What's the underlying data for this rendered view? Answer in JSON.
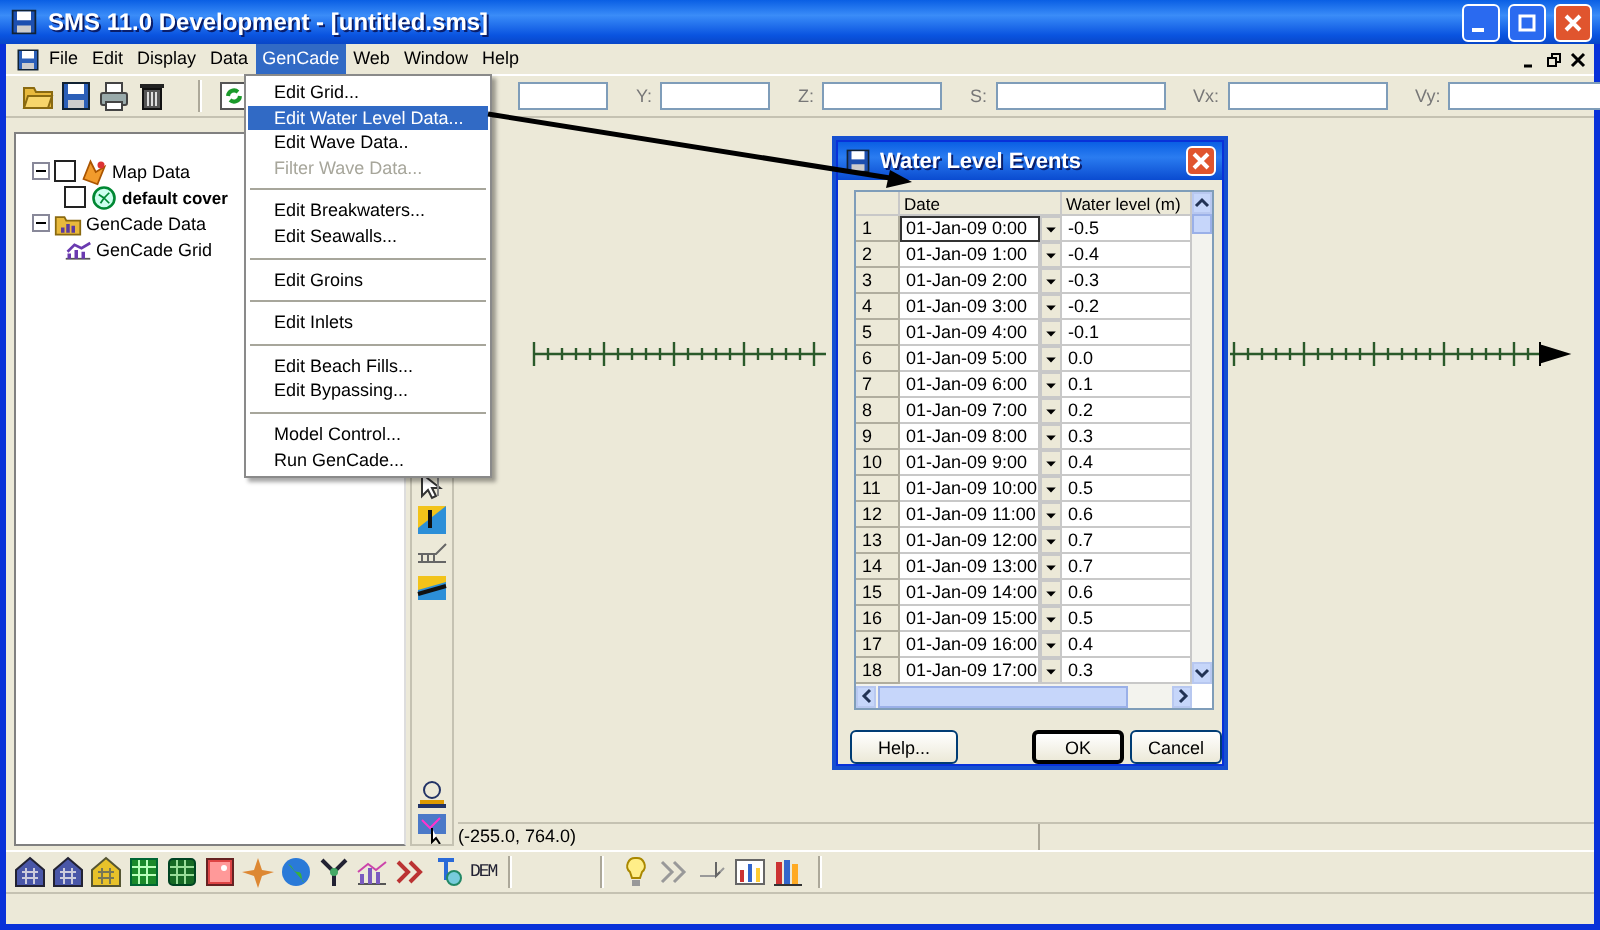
{
  "window": {
    "title": "SMS 11.0 Development - [untitled.sms]"
  },
  "menu_bar": [
    {
      "label": "File",
      "selected": false
    },
    {
      "label": "Edit",
      "selected": false
    },
    {
      "label": "Display",
      "selected": false
    },
    {
      "label": "Data",
      "selected": false
    },
    {
      "label": "GenCade",
      "selected": true
    },
    {
      "label": "Web",
      "selected": false
    },
    {
      "label": "Window",
      "selected": false
    },
    {
      "label": "Help",
      "selected": false
    }
  ],
  "open_menu": {
    "groups": [
      [
        {
          "label": "Edit Grid...",
          "selected": false,
          "disabled": false
        },
        {
          "label": "Edit Water Level Data...",
          "selected": true,
          "disabled": false
        },
        {
          "label": "Edit Wave Data..",
          "selected": false,
          "disabled": false
        },
        {
          "label": "Filter Wave Data...",
          "selected": false,
          "disabled": true
        }
      ],
      [
        {
          "label": "Edit Breakwaters...",
          "selected": false,
          "disabled": false
        },
        {
          "label": "Edit Seawalls...",
          "selected": false,
          "disabled": false
        }
      ],
      [
        {
          "label": "Edit Groins",
          "selected": false,
          "disabled": false
        }
      ],
      [
        {
          "label": "Edit Inlets",
          "selected": false,
          "disabled": false
        }
      ],
      [
        {
          "label": "Edit Beach Fills...",
          "selected": false,
          "disabled": false
        },
        {
          "label": "Edit Bypassing...",
          "selected": false,
          "disabled": false
        }
      ],
      [
        {
          "label": "Model Control...",
          "selected": false,
          "disabled": false
        },
        {
          "label": "Run GenCade...",
          "selected": false,
          "disabled": false
        }
      ]
    ]
  },
  "coordinate_fields": [
    {
      "label": "Y:"
    },
    {
      "label": "Z:"
    },
    {
      "label": "S:"
    },
    {
      "label": "Vx:"
    },
    {
      "label": "Vy:"
    }
  ],
  "tree": [
    {
      "label": "Map Data",
      "expanded": true,
      "checked": false,
      "active": false,
      "children": [
        {
          "label": "default cover",
          "checked": false,
          "active": true
        }
      ]
    },
    {
      "label": "GenCade Data",
      "expanded": true,
      "active": false,
      "children": [
        {
          "label": "GenCade Grid",
          "active": false
        }
      ]
    }
  ],
  "status": {
    "coordinates": "(-255.0, 764.0)"
  },
  "bottom_toolbar": {
    "dem_button": "DEM"
  },
  "dialog": {
    "title": "Water Level Events",
    "columns": [
      "Date",
      "Water level (m)"
    ],
    "rows": [
      {
        "number": "1",
        "date": "01-Jan-09 0:00",
        "water_level": "-0.5",
        "focused": true
      },
      {
        "number": "2",
        "date": "01-Jan-09 1:00",
        "water_level": "-0.4",
        "focused": false
      },
      {
        "number": "3",
        "date": "01-Jan-09 2:00",
        "water_level": "-0.3",
        "focused": false
      },
      {
        "number": "4",
        "date": "01-Jan-09 3:00",
        "water_level": "-0.2",
        "focused": false
      },
      {
        "number": "5",
        "date": "01-Jan-09 4:00",
        "water_level": "-0.1",
        "focused": false
      },
      {
        "number": "6",
        "date": "01-Jan-09 5:00",
        "water_level": "0.0",
        "focused": false
      },
      {
        "number": "7",
        "date": "01-Jan-09 6:00",
        "water_level": "0.1",
        "focused": false
      },
      {
        "number": "8",
        "date": "01-Jan-09 7:00",
        "water_level": "0.2",
        "focused": false
      },
      {
        "number": "9",
        "date": "01-Jan-09 8:00",
        "water_level": "0.3",
        "focused": false
      },
      {
        "number": "10",
        "date": "01-Jan-09 9:00",
        "water_level": "0.4",
        "focused": false
      },
      {
        "number": "11",
        "date": "01-Jan-09 10:00",
        "water_level": "0.5",
        "focused": false
      },
      {
        "number": "12",
        "date": "01-Jan-09 11:00",
        "water_level": "0.6",
        "focused": false
      },
      {
        "number": "13",
        "date": "01-Jan-09 12:00",
        "water_level": "0.7",
        "focused": false
      },
      {
        "number": "14",
        "date": "01-Jan-09 13:00",
        "water_level": "0.7",
        "focused": false
      },
      {
        "number": "15",
        "date": "01-Jan-09 14:00",
        "water_level": "0.6",
        "focused": false
      },
      {
        "number": "16",
        "date": "01-Jan-09 15:00",
        "water_level": "0.5",
        "focused": false
      },
      {
        "number": "17",
        "date": "01-Jan-09 16:00",
        "water_level": "0.4",
        "focused": false
      },
      {
        "number": "18",
        "date": "01-Jan-09 17:00",
        "water_level": "0.3",
        "focused": false
      }
    ],
    "buttons": [
      {
        "label": "Help...",
        "default": false
      },
      {
        "label": "OK",
        "default": true
      },
      {
        "label": "Cancel",
        "default": false
      }
    ]
  }
}
